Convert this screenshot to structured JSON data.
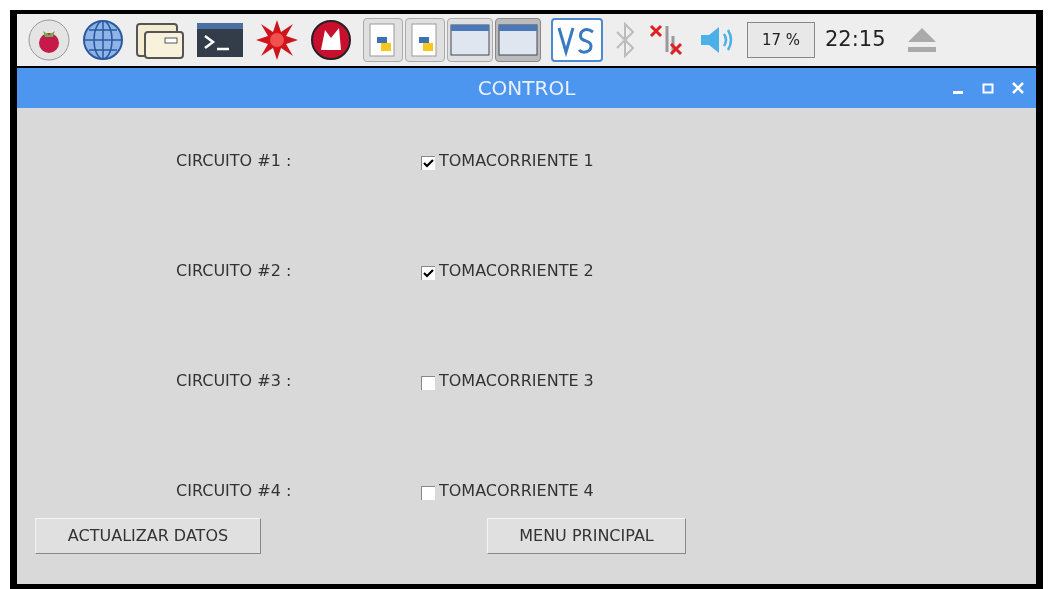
{
  "taskbar": {
    "cpu_usage": "17 %",
    "clock": "22:15"
  },
  "window": {
    "title": "CONTROL"
  },
  "circuits": [
    {
      "label": "CIRCUITO #1 :",
      "outlet": "TOMACORRIENTE 1",
      "checked": true
    },
    {
      "label": "CIRCUITO #2 :",
      "outlet": "TOMACORRIENTE 2",
      "checked": true
    },
    {
      "label": "CIRCUITO #3 :",
      "outlet": "TOMACORRIENTE 3",
      "checked": false
    },
    {
      "label": "CIRCUITO #4 :",
      "outlet": "TOMACORRIENTE 4",
      "checked": false
    }
  ],
  "buttons": [
    "ACTUALIZAR DATOS",
    "MENU PRINCIPAL"
  ]
}
